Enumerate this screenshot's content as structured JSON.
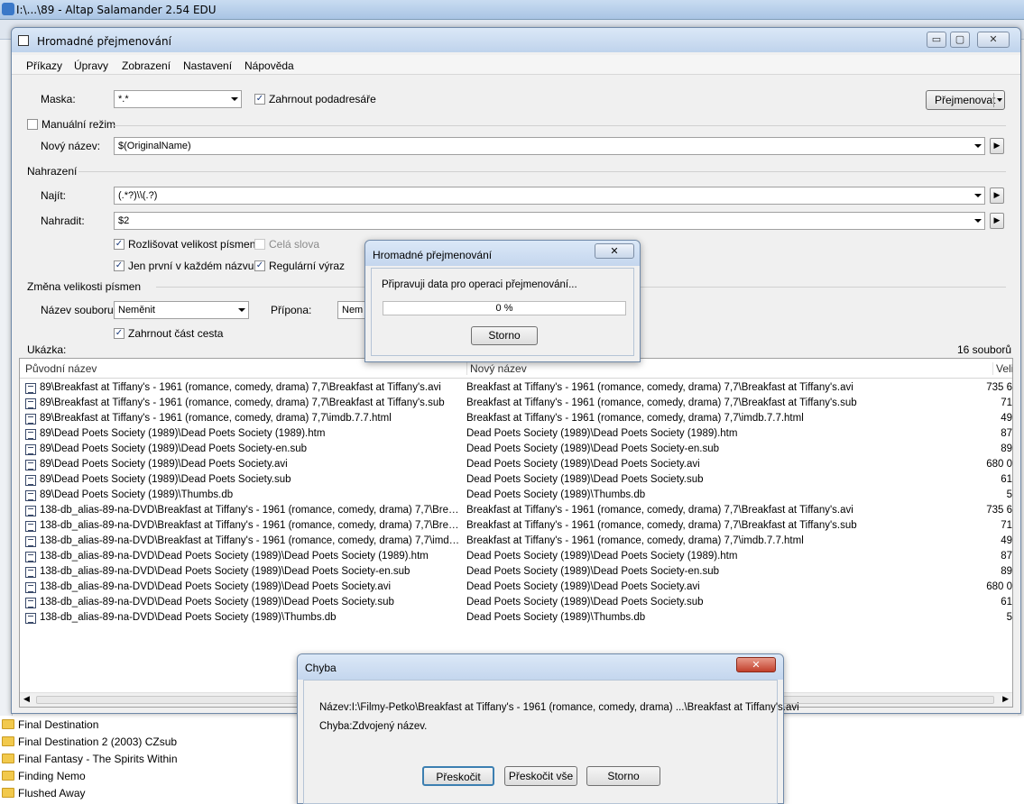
{
  "app": {
    "title": "I:\\...\\89 - Altap Salamander 2.54 EDU"
  },
  "background_list": [
    "Final Destination",
    "Final Destination 2 (2003) CZsub",
    "Final Fantasy - The Spirits Within",
    "Finding Nemo",
    "Flushed Away"
  ],
  "rename_window": {
    "title": "Hromadné přejmenování",
    "caption_buttons": {
      "minimize": "▭",
      "maximize": "▢",
      "close": "✕"
    },
    "menu": [
      "Příkazy",
      "Úpravy",
      "Zobrazení",
      "Nastavení",
      "Nápověda"
    ],
    "mask_label": "Maska:",
    "mask_value": "*.*",
    "subdirs_label": "Zahrnout podadresáře",
    "subdirs_checked": "✓",
    "rename_button": "Přejmenovat",
    "manual_label": "Manuální režim",
    "new_name_label": "Nový název:",
    "new_name_value": "$(OriginalName)",
    "replace_section": "Nahrazení",
    "find_label": "Najít:",
    "find_value": "(.*?)\\\\(.?)",
    "replace_label": "Nahradit:",
    "replace_value": "$2",
    "case_sensitive_label": "Rozlišovat velikost písmen",
    "whole_words_label": "Celá slova",
    "first_only_label": "Jen první v každém názvu",
    "regex_label": "Regulární výraz",
    "case_section": "Změna velikosti písmen",
    "filename_label": "Název souboru:",
    "filename_value": "Neměnit",
    "ext_label": "Přípona:",
    "ext_value": "Nem",
    "include_path_label": "Zahrnout část cesta",
    "preview_label": "Ukázka:",
    "file_count": "16 souborů",
    "columns": [
      "Původní název",
      "Nový název",
      "Veli"
    ],
    "rows": [
      {
        "orig": "89\\Breakfast at Tiffany's - 1961 (romance, comedy, drama) 7,7\\Breakfast at Tiffany's.avi",
        "new": "Breakfast at Tiffany's - 1961 (romance, comedy, drama) 7,7\\Breakfast at Tiffany's.avi",
        "size": "735 6"
      },
      {
        "orig": "89\\Breakfast at Tiffany's - 1961 (romance, comedy, drama) 7,7\\Breakfast at Tiffany's.sub",
        "new": "Breakfast at Tiffany's - 1961 (romance, comedy, drama) 7,7\\Breakfast at Tiffany's.sub",
        "size": "71"
      },
      {
        "orig": "89\\Breakfast at Tiffany's - 1961 (romance, comedy, drama) 7,7\\imdb.7.7.html",
        "new": "Breakfast at Tiffany's - 1961 (romance, comedy, drama) 7,7\\imdb.7.7.html",
        "size": "49"
      },
      {
        "orig": "89\\Dead Poets Society (1989)\\Dead Poets Society (1989).htm",
        "new": "Dead Poets Society (1989)\\Dead Poets Society (1989).htm",
        "size": "87"
      },
      {
        "orig": "89\\Dead Poets Society (1989)\\Dead Poets Society-en.sub",
        "new": "Dead Poets Society (1989)\\Dead Poets Society-en.sub",
        "size": "89"
      },
      {
        "orig": "89\\Dead Poets Society (1989)\\Dead Poets Society.avi",
        "new": "Dead Poets Society (1989)\\Dead Poets Society.avi",
        "size": "680 0"
      },
      {
        "orig": "89\\Dead Poets Society (1989)\\Dead Poets Society.sub",
        "new": "Dead Poets Society (1989)\\Dead Poets Society.sub",
        "size": "61"
      },
      {
        "orig": "89\\Dead Poets Society (1989)\\Thumbs.db",
        "new": "Dead Poets Society (1989)\\Thumbs.db",
        "size": "5"
      },
      {
        "orig": "138-db_alias-89-na-DVD\\Breakfast at Tiffany's - 1961 (romance, comedy, drama) 7,7\\Breakfast ...",
        "new": "Breakfast at Tiffany's - 1961 (romance, comedy, drama) 7,7\\Breakfast at Tiffany's.avi",
        "size": "735 6"
      },
      {
        "orig": "138-db_alias-89-na-DVD\\Breakfast at Tiffany's - 1961 (romance, comedy, drama) 7,7\\Breakfast ...",
        "new": "Breakfast at Tiffany's - 1961 (romance, comedy, drama) 7,7\\Breakfast at Tiffany's.sub",
        "size": "71"
      },
      {
        "orig": "138-db_alias-89-na-DVD\\Breakfast at Tiffany's - 1961 (romance, comedy, drama) 7,7\\imdb.7.7.ht...",
        "new": "Breakfast at Tiffany's - 1961 (romance, comedy, drama) 7,7\\imdb.7.7.html",
        "size": "49"
      },
      {
        "orig": "138-db_alias-89-na-DVD\\Dead Poets Society (1989)\\Dead Poets Society (1989).htm",
        "new": "Dead Poets Society (1989)\\Dead Poets Society (1989).htm",
        "size": "87"
      },
      {
        "orig": "138-db_alias-89-na-DVD\\Dead Poets Society (1989)\\Dead Poets Society-en.sub",
        "new": "Dead Poets Society (1989)\\Dead Poets Society-en.sub",
        "size": "89"
      },
      {
        "orig": "138-db_alias-89-na-DVD\\Dead Poets Society (1989)\\Dead Poets Society.avi",
        "new": "Dead Poets Society (1989)\\Dead Poets Society.avi",
        "size": "680 0"
      },
      {
        "orig": "138-db_alias-89-na-DVD\\Dead Poets Society (1989)\\Dead Poets Society.sub",
        "new": "Dead Poets Society (1989)\\Dead Poets Society.sub",
        "size": "61"
      },
      {
        "orig": "138-db_alias-89-na-DVD\\Dead Poets Society (1989)\\Thumbs.db",
        "new": "Dead Poets Society (1989)\\Thumbs.db",
        "size": "5"
      }
    ]
  },
  "progress_dialog": {
    "title": "Hromadné přejmenování",
    "close": "✕",
    "message": "Připravuji data pro operaci přejmenování...",
    "progress_text": "0 %",
    "progress": 0,
    "cancel_button": "Storno"
  },
  "error_dialog": {
    "title": "Chyba",
    "close": "✕",
    "name_line": "Název:I:\\Filmy-Petko\\Breakfast at Tiffany's - 1961 (romance, comedy, drama) ...\\Breakfast at Tiffany's.avi",
    "error_line": "Chyba:Zdvojený název.",
    "skip_button": "Přeskočit",
    "skip_all_button": "Přeskočit vše",
    "cancel_button": "Storno"
  }
}
